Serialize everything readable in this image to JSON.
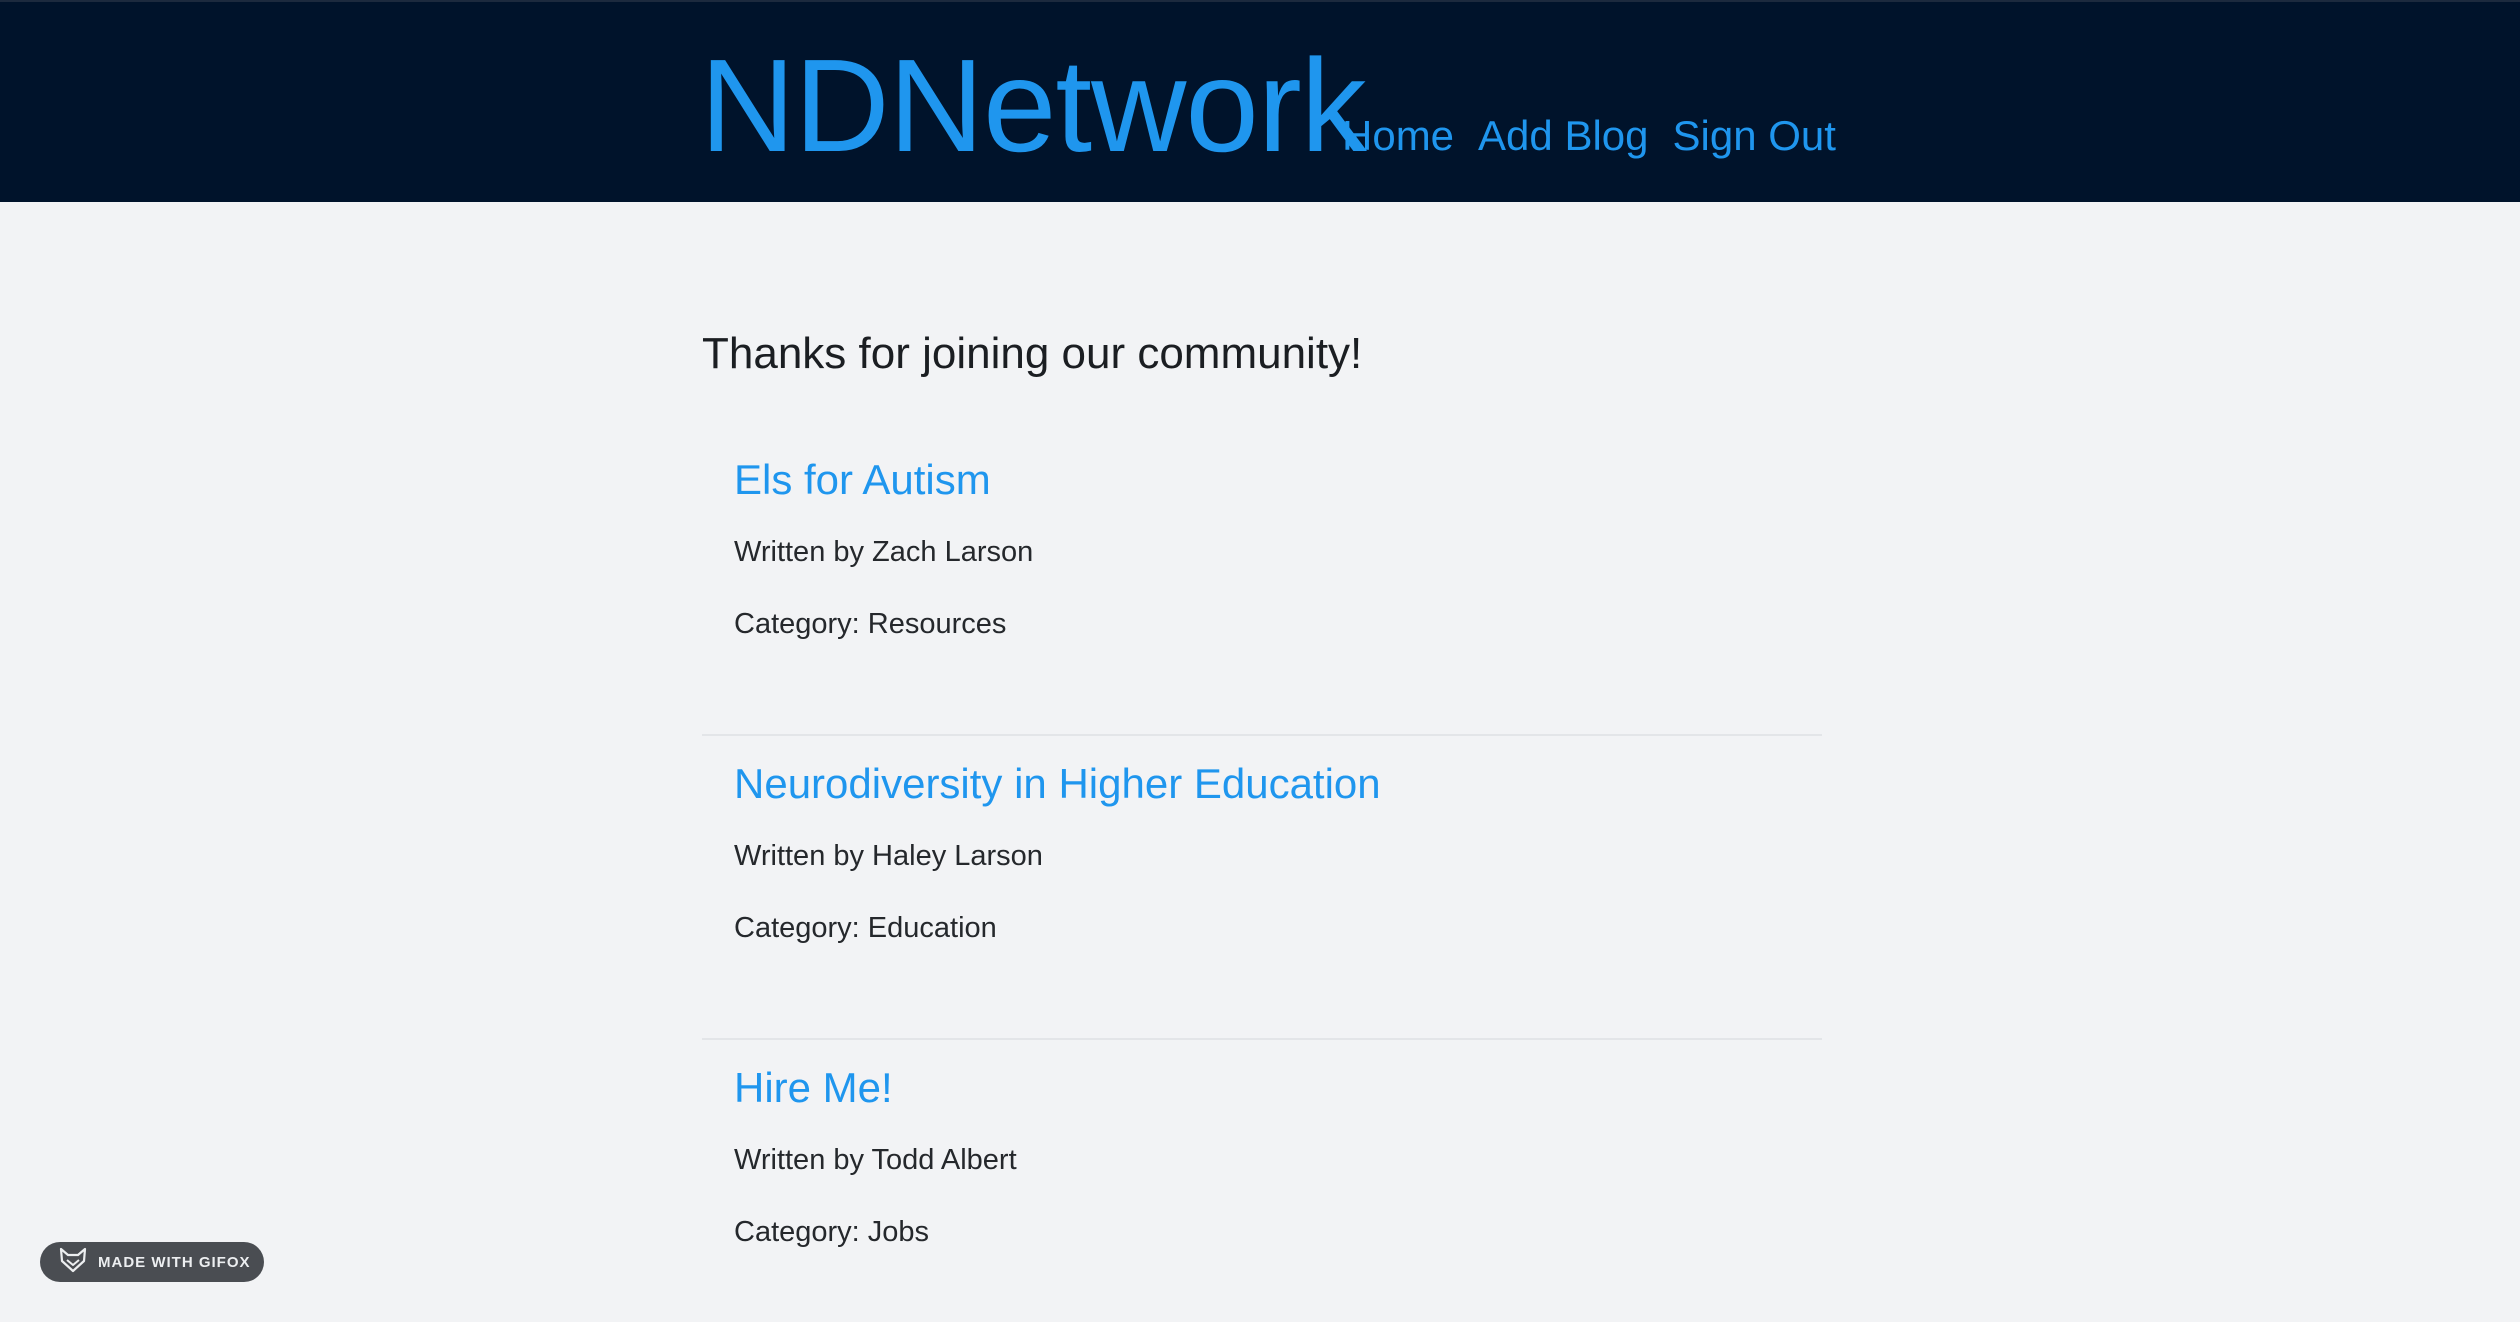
{
  "header": {
    "brand": "NDNetwork",
    "nav": [
      {
        "label": "Home"
      },
      {
        "label": "Add Blog"
      },
      {
        "label": "Sign Out"
      }
    ]
  },
  "main": {
    "welcome": "Thanks for joining our community!",
    "blogs": [
      {
        "title": "Els for Autism",
        "author": "Written by Zach Larson",
        "category": "Category: Resources"
      },
      {
        "title": "Neurodiversity in Higher Education",
        "author": "Written by Haley Larson",
        "category": "Category: Education"
      },
      {
        "title": "Hire Me!",
        "author": "Written by Todd Albert",
        "category": "Category: Jobs"
      }
    ]
  },
  "watermark": {
    "text": "MADE WITH GIFOX",
    "icon": "fox-icon"
  },
  "colors": {
    "header_bg": "#00132b",
    "accent": "#1f96ee",
    "page_bg": "#f2f3f5",
    "text": "#1b1e22"
  }
}
